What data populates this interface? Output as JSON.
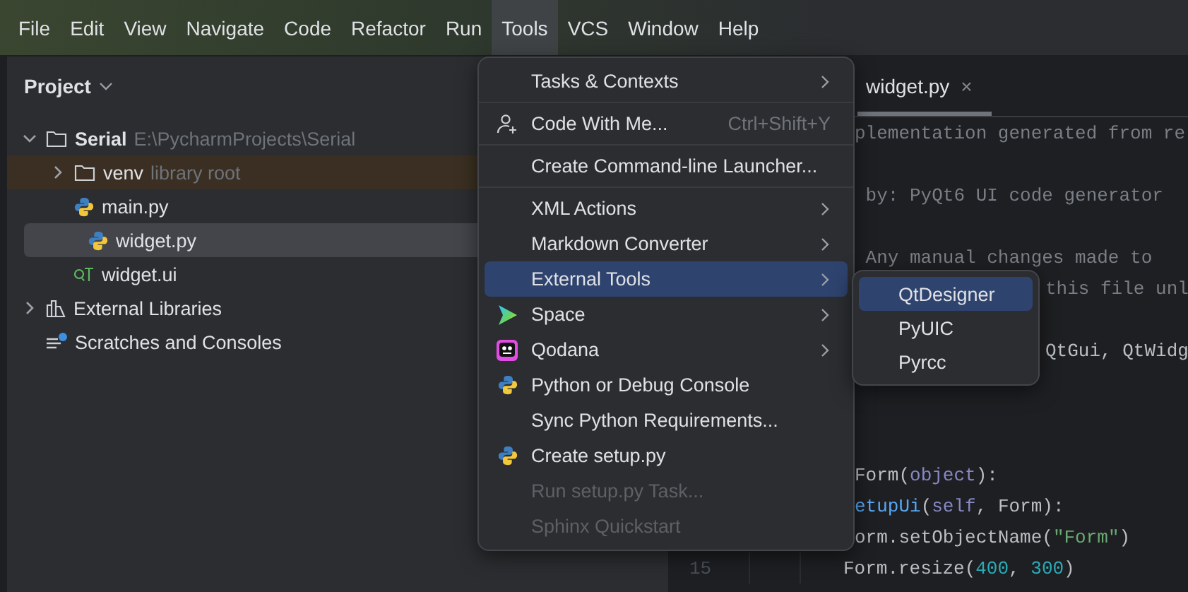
{
  "menubar": [
    {
      "label": "File",
      "selected": false
    },
    {
      "label": "Edit",
      "selected": false
    },
    {
      "label": "View",
      "selected": false
    },
    {
      "label": "Navigate",
      "selected": false
    },
    {
      "label": "Code",
      "selected": false
    },
    {
      "label": "Refactor",
      "selected": false
    },
    {
      "label": "Run",
      "selected": false
    },
    {
      "label": "Tools",
      "selected": true
    },
    {
      "label": "VCS",
      "selected": false
    },
    {
      "label": "Window",
      "selected": false
    },
    {
      "label": "Help",
      "selected": false
    }
  ],
  "project": {
    "title": "Project",
    "tree": [
      {
        "kind": "folder",
        "label": "Serial",
        "note": "E:\\PycharmProjects\\Serial",
        "expanded": true,
        "selected": false,
        "children": [
          {
            "kind": "folder",
            "label": "venv",
            "note": "library root",
            "expanded": false,
            "selected": false,
            "library": true
          },
          {
            "kind": "python",
            "label": "main.py",
            "selected": false
          },
          {
            "kind": "python",
            "label": "widget.py",
            "selected": true
          },
          {
            "kind": "qt",
            "label": "widget.ui",
            "selected": false
          }
        ]
      },
      {
        "kind": "libraries",
        "label": "External Libraries",
        "expanded": false,
        "selected": false
      },
      {
        "kind": "scratches",
        "label": "Scratches and Consoles",
        "selected": false
      }
    ]
  },
  "editor": {
    "tab": {
      "label": "widget.py",
      "close": "×",
      "selected": true
    },
    "lines": [
      {
        "kind": "menu_edge",
        "tokens": [
          {
            "kind": "comment",
            "text": "plementation generated from re"
          }
        ]
      },
      {
        "kind": "blank"
      },
      {
        "kind": "menu_edge",
        "tokens": [
          {
            "kind": "comment",
            "text": " by: PyQt6 UI code generator"
          }
        ]
      },
      {
        "kind": "blank"
      },
      {
        "kind": "menu_edge",
        "tokens": [
          {
            "kind": "comment",
            "text": " Any manual changes made to"
          }
        ]
      },
      {
        "kind": "submenu_edge",
        "tokens": [
          {
            "kind": "comment",
            "text": "this file unl"
          }
        ]
      },
      {
        "kind": "blank"
      },
      {
        "kind": "submenu_edge",
        "tokens": [
          {
            "kind": "plain",
            "text": "QtGui, QtWidg"
          }
        ]
      },
      {
        "kind": "blank"
      },
      {
        "kind": "blank"
      },
      {
        "kind": "blank"
      },
      {
        "kind": "menu_edge",
        "tokens": [
          {
            "kind": "plain",
            "text": "Form("
          },
          {
            "kind": "builtin",
            "text": "object"
          },
          {
            "kind": "plain",
            "text": "):"
          }
        ]
      },
      {
        "kind": "menu_edge",
        "tokens": [
          {
            "kind": "func",
            "text": "etupUi"
          },
          {
            "kind": "plain",
            "text": "("
          },
          {
            "kind": "builtin",
            "text": "self"
          },
          {
            "kind": "plain",
            "text": ", Form):"
          }
        ]
      },
      {
        "kind": "menu_edge",
        "tokens": [
          {
            "kind": "plain",
            "text": "orm.setObjectName("
          },
          {
            "kind": "string",
            "text": "\"Form\""
          },
          {
            "kind": "plain",
            "text": ")"
          }
        ]
      },
      {
        "kind": "code",
        "number": "15",
        "tokens": [
          {
            "kind": "plain",
            "text": "Form.resize("
          },
          {
            "kind": "number",
            "text": "400"
          },
          {
            "kind": "plain",
            "text": ", "
          },
          {
            "kind": "number",
            "text": "300"
          },
          {
            "kind": "plain",
            "text": ")"
          }
        ]
      }
    ]
  },
  "tools_menu": {
    "items": [
      {
        "kind": "plain",
        "label": "Tasks & Contexts",
        "submenu": true,
        "disabled": false,
        "selected": false,
        "separator_after": true
      },
      {
        "kind": "people",
        "label": "Code With Me...",
        "shortcut": "Ctrl+Shift+Y",
        "disabled": false,
        "selected": false,
        "separator_after": true
      },
      {
        "kind": "plain",
        "label": "Create Command-line Launcher...",
        "disabled": false,
        "selected": false,
        "separator_after": true
      },
      {
        "kind": "plain",
        "label": "XML Actions",
        "submenu": true,
        "disabled": false,
        "selected": false
      },
      {
        "kind": "plain",
        "label": "Markdown Converter",
        "submenu": true,
        "disabled": false,
        "selected": false
      },
      {
        "kind": "plain",
        "label": "External Tools",
        "submenu": true,
        "disabled": false,
        "selected": true
      },
      {
        "kind": "space",
        "label": "Space",
        "submenu": true,
        "disabled": false,
        "selected": false
      },
      {
        "kind": "qodana",
        "label": "Qodana",
        "submenu": true,
        "disabled": false,
        "selected": false
      },
      {
        "kind": "python",
        "label": "Python or Debug Console",
        "disabled": false,
        "selected": false
      },
      {
        "kind": "plain",
        "label": "Sync Python Requirements...",
        "disabled": false,
        "selected": false
      },
      {
        "kind": "python",
        "label": "Create setup.py",
        "disabled": false,
        "selected": false
      },
      {
        "kind": "plain",
        "label": "Run setup.py Task...",
        "disabled": true,
        "selected": false
      },
      {
        "kind": "plain",
        "label": "Sphinx Quickstart",
        "disabled": true,
        "selected": false
      }
    ]
  },
  "external_tools_submenu": {
    "items": [
      {
        "label": "QtDesigner",
        "selected": true
      },
      {
        "label": "PyUIC",
        "selected": false
      },
      {
        "label": "Pyrcc",
        "selected": false
      }
    ]
  }
}
